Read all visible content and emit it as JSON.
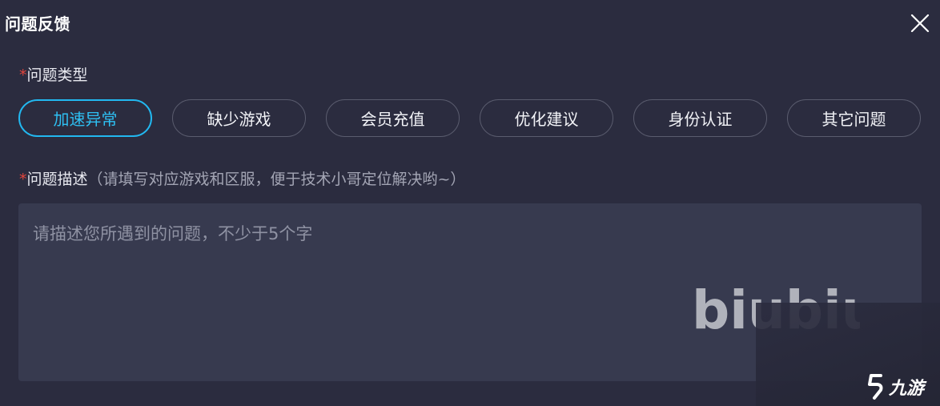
{
  "dialog": {
    "title": "问题反馈",
    "close_icon": "close-icon"
  },
  "type_section": {
    "required_mark": "*",
    "label": "问题类型",
    "options": [
      {
        "label": "加速异常",
        "selected": true
      },
      {
        "label": "缺少游戏",
        "selected": false
      },
      {
        "label": "会员充值",
        "selected": false
      },
      {
        "label": "优化建议",
        "selected": false
      },
      {
        "label": "身份认证",
        "selected": false
      },
      {
        "label": "其它问题",
        "selected": false
      }
    ]
  },
  "desc_section": {
    "required_mark": "*",
    "label": "问题描述",
    "hint": "（请填写对应游戏和区服，便于技术小哥定位解决哟~）",
    "placeholder": "请描述您所遇到的问题，不少于5个字"
  },
  "watermark": {
    "text": "biubiu"
  },
  "corner_logo": {
    "text": "九游"
  },
  "colors": {
    "background": "#2b2c3f",
    "input_bg": "#373a4f",
    "accent": "#22b8f0",
    "required": "#e2453c"
  }
}
